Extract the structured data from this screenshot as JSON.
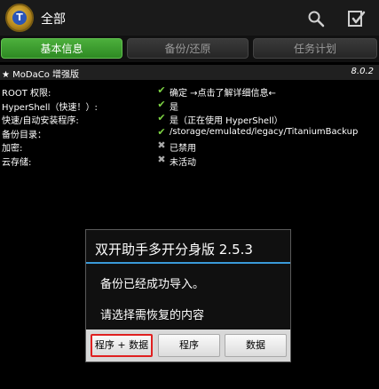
{
  "header": {
    "title": "全部",
    "logo_letter": "T"
  },
  "tabs": [
    {
      "label": "基本信息",
      "active": true
    },
    {
      "label": "备份/还原",
      "active": false
    },
    {
      "label": "任务计划",
      "active": false
    }
  ],
  "edition": {
    "name": "★ MoDaCo 增强版",
    "version": "8.0.2"
  },
  "info_rows": [
    {
      "label": "ROOT 权限:",
      "status": "ok",
      "value": "确定 →点击了解详细信息←"
    },
    {
      "label": "HyperShell（快速！）:",
      "status": "ok",
      "value": "是"
    },
    {
      "label": "快速/自动安装程序:",
      "status": "ok",
      "value": "是（正在使用 HyperShell）"
    },
    {
      "label": "备份目录：",
      "status": "ok",
      "value": "/storage/emulated/legacy/TitaniumBackup"
    },
    {
      "label": "加密:",
      "status": "no",
      "value": "已禁用"
    },
    {
      "label": "云存储:",
      "status": "no",
      "value": "未活动"
    }
  ],
  "dialog": {
    "title": "双开助手多开分身版 2.5.3",
    "message1": "备份已经成功导入。",
    "message2": "请选择需恢复的内容",
    "buttons": [
      "程序 + 数据",
      "程序",
      "数据"
    ]
  },
  "colors": {
    "ok": "#7ed444",
    "no": "#a8a8a8",
    "accent": "#3a9ad9",
    "tab_active": "#2e8a23"
  }
}
